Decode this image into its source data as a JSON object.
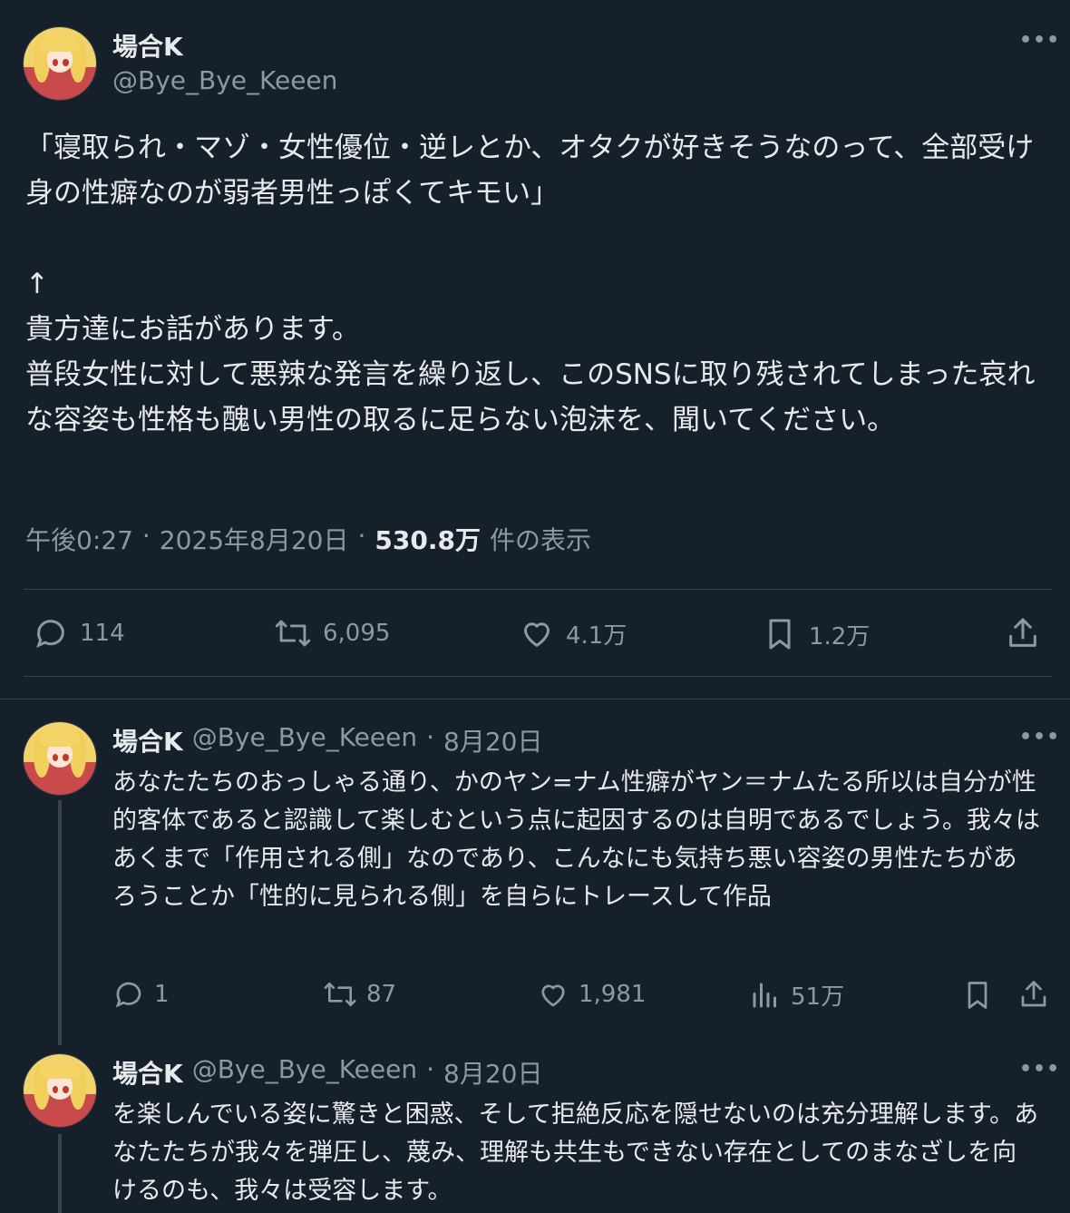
{
  "main_tweet": {
    "display_name": "場合K",
    "handle": "@Bye_Bye_Keeen",
    "text": "「寝取られ・マゾ・女性優位・逆レとか、オタクが好きそうなのって、全部受け身の性癖なのが弱者男性っぽくてキモい」\n\n↑\n貴方達にお話があります。\n普段女性に対して悪辣な発言を繰り返し、このSNSに取り残されてしまった哀れな容姿も性格も醜い男性の取るに足らない泡沫を、聞いてください。",
    "time": "午後0:27",
    "date": "2025年8月20日",
    "views_count": "530.8万",
    "views_label": "件の表示",
    "replies": "114",
    "retweets": "6,095",
    "likes": "4.1万",
    "bookmarks": "1.2万"
  },
  "replies": [
    {
      "display_name": "場合K",
      "handle": "@Bye_Bye_Keeen",
      "date": "8月20日",
      "text": "あなたたちのおっしゃる通り、かのヤン=ナム性癖がヤン＝ナムたる所以は自分が性的客体であると認識して楽しむという点に起因するのは自明であるでしょう。我々はあくまで「作用される側」なのであり、こんなにも気持ち悪い容姿の男性たちがあろうことか「性的に見られる側」を自らにトレースして作品",
      "replies": "1",
      "retweets": "87",
      "likes": "1,981",
      "views": "51万"
    },
    {
      "display_name": "場合K",
      "handle": "@Bye_Bye_Keeen",
      "date": "8月20日",
      "text": "を楽しんでいる姿に驚きと困惑、そして拒絶反応を隠せないのは充分理解します。あなたたちが我々を弾圧し、蔑み、理解も共生もできない存在としてのまなざしを向けるのも、我々は受容します。"
    }
  ],
  "separator": "·",
  "icons": [
    "reply-icon",
    "retweet-icon",
    "like-icon",
    "bookmark-icon",
    "share-icon",
    "views-icon",
    "more-icon"
  ]
}
